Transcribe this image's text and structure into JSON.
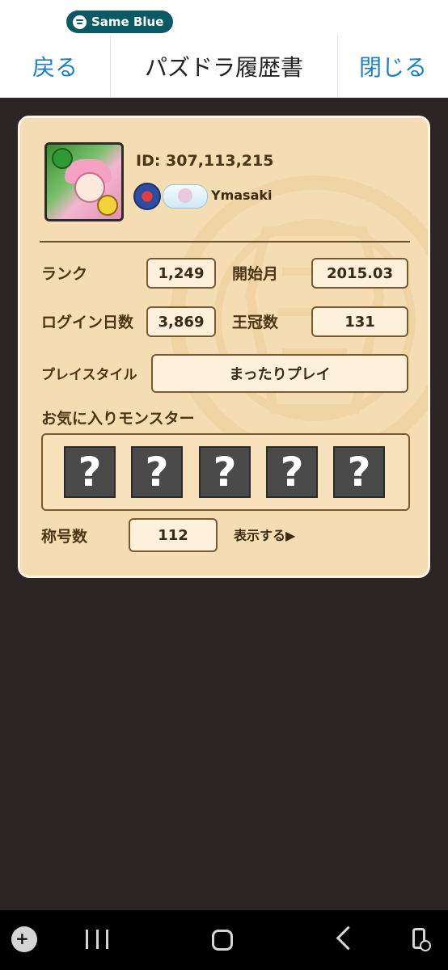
{
  "statusbar": {
    "media_title": "Same Blue"
  },
  "header": {
    "back_label": "戻る",
    "title": "パズドラ履歴書",
    "close_label": "閉じる"
  },
  "profile": {
    "id_text": "ID: 307,113,215",
    "name": "Ymasaki"
  },
  "stats": {
    "rank_label": "ランク",
    "rank_value": "1,249",
    "start_label": "開始月",
    "start_value": "2015.03",
    "login_label": "ログイン日数",
    "login_value": "3,869",
    "crown_label": "王冠数",
    "crown_value": "131",
    "style_label": "プレイスタイル",
    "style_value": "まったりプレイ",
    "fav_label": "お気に入りモンスター",
    "fav_slots": [
      "?",
      "?",
      "?",
      "?",
      "?"
    ],
    "title_label": "称号数",
    "title_value": "112",
    "show_link": "表示する▶"
  },
  "colors": {
    "card_bg": "#f5ddb3",
    "accent_blue": "#1d7fc4",
    "text_brown": "#4a3617"
  },
  "nav_icons": [
    "game-tools-icon",
    "recent-apps-icon",
    "home-icon",
    "back-icon",
    "phone-block-icon"
  ]
}
